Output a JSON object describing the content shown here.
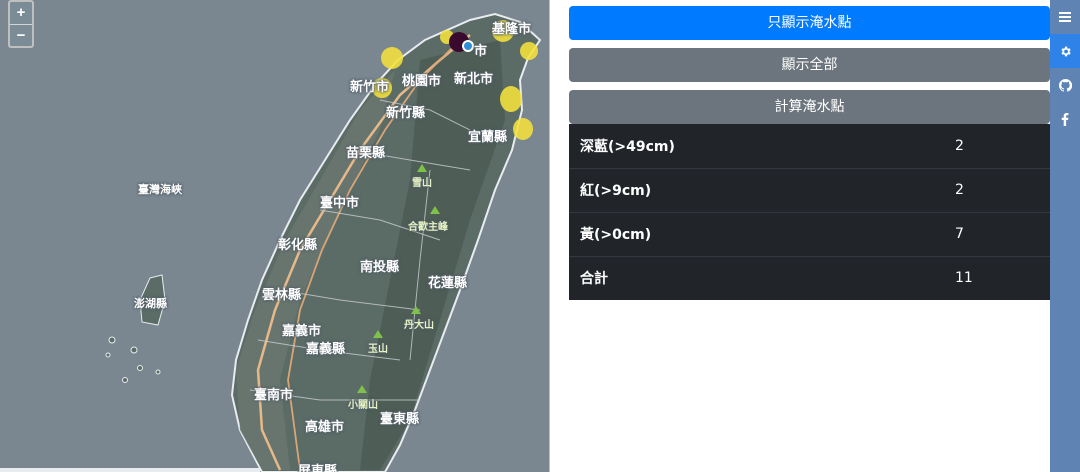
{
  "map": {
    "zoom_in": "+",
    "zoom_out": "−",
    "labels": {
      "keelung": "基隆市",
      "taipei": "市",
      "hsinchu_city": "新竹市",
      "taoyuan": "桃園市",
      "new_taipei": "新北市",
      "hsinchu_county": "新竹縣",
      "yilan": "宜蘭縣",
      "miaoli": "苗栗縣",
      "xueshan": "雪山",
      "strait": "臺灣海峽",
      "taichung": "臺中市",
      "hehuan": "合歡主峰",
      "changhua": "彰化縣",
      "nantou": "南投縣",
      "hualien": "花蓮縣",
      "penghu": "澎湖縣",
      "yunlin": "雲林縣",
      "dandashan": "丹大山",
      "chiayi_city": "嘉義市",
      "yushan": "玉山",
      "chiayi_county": "嘉義縣",
      "tainan": "臺南市",
      "xiaoguanshan": "小關山",
      "kaohsiung": "高雄市",
      "taitung": "臺東縣",
      "pingtung": "屏東縣"
    }
  },
  "actions": {
    "show_flooded": "只顯示淹水點",
    "show_all": "顯示全部",
    "calculate": "計算淹水點"
  },
  "summary": [
    {
      "label": "深藍(>49cm)",
      "count": "2"
    },
    {
      "label": "紅(>9cm)",
      "count": "2"
    },
    {
      "label": "黃(>0cm)",
      "count": "7"
    },
    {
      "label": "合計",
      "count": "11"
    }
  ],
  "sidebar_icons": [
    "menu-icon",
    "gear-icon",
    "github-icon",
    "facebook-icon"
  ],
  "colors": {
    "primary": "#007bff",
    "secondary": "#6c757d",
    "table_dark": "#212529",
    "sidebar": "#5f83b2",
    "marker_yellow": "#f5e13c",
    "marker_dark": "#3a0a2e",
    "marker_blue": "#2f8fd8"
  }
}
